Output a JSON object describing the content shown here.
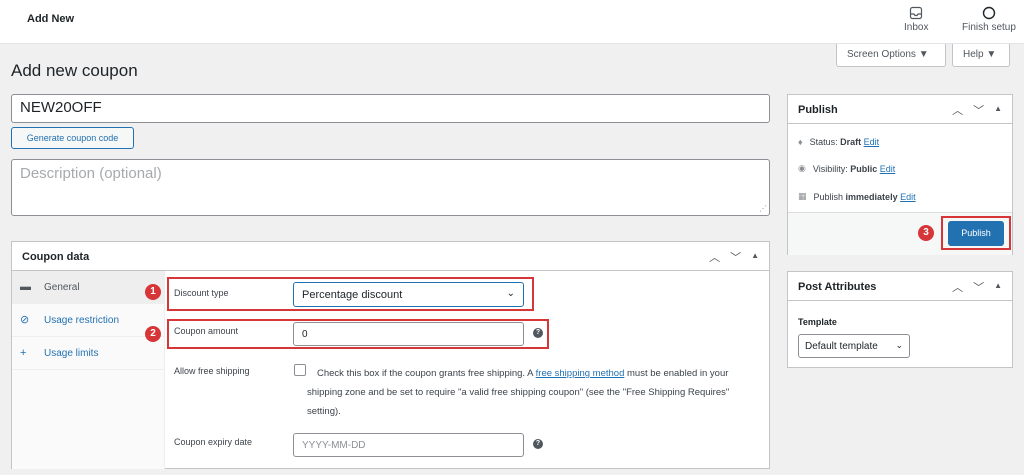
{
  "topbar": {
    "title": "Add New",
    "inbox_label": "Inbox",
    "finish_label": "Finish setup"
  },
  "screen_options": "Screen Options ▼",
  "help_tab": "Help ▼",
  "page_title": "Add new coupon",
  "coupon_code": {
    "value": "NEW20OFF"
  },
  "generate_button": "Generate coupon code",
  "description": {
    "placeholder": "Description (optional)"
  },
  "coupon_data": {
    "title": "Coupon data",
    "tabs": [
      {
        "label": "General",
        "icon": "ticket-icon"
      },
      {
        "label": "Usage restriction",
        "icon": "block-icon"
      },
      {
        "label": "Usage limits",
        "icon": "plus-icon"
      }
    ],
    "discount_type_label": "Discount type",
    "discount_type_value": "Percentage discount",
    "coupon_amount_label": "Coupon amount",
    "coupon_amount_value": "0",
    "free_shipping_label": "Allow free shipping",
    "free_shipping_text_1": "Check this box if the coupon grants free shipping. A ",
    "free_shipping_link": "free shipping method",
    "free_shipping_text_2": " must be enabled in your shipping zone and be set to require \"a valid free shipping coupon\" (see the \"Free Shipping Requires\" setting).",
    "expiry_label": "Coupon expiry date",
    "expiry_placeholder": "YYYY-MM-DD"
  },
  "publish": {
    "title": "Publish",
    "status_label": "Status: ",
    "status_value": "Draft",
    "visibility_label": "Visibility: ",
    "visibility_value": "Public",
    "schedule_label": "Publish ",
    "schedule_value": "immediately",
    "edit_label": "Edit",
    "button": "Publish"
  },
  "post_attributes": {
    "title": "Post Attributes",
    "template_label": "Template",
    "template_value": "Default template"
  },
  "markers": [
    "1",
    "2",
    "3"
  ],
  "colors": {
    "accent": "#2271b1",
    "highlight": "#d63638"
  }
}
